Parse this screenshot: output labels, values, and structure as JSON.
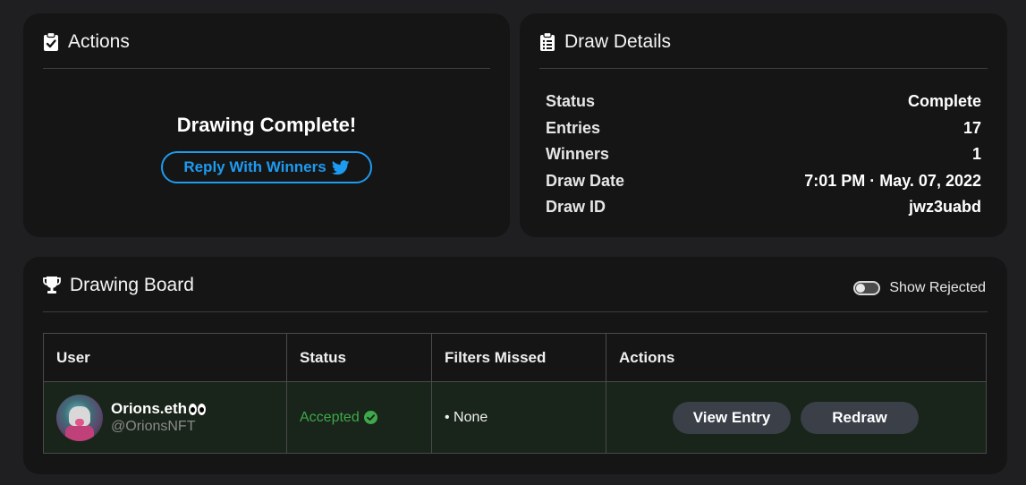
{
  "actions": {
    "title": "Actions",
    "complete_text": "Drawing Complete!",
    "reply_button_label": "Reply With Winners"
  },
  "details": {
    "title": "Draw Details",
    "rows": [
      {
        "label": "Status",
        "value": "Complete"
      },
      {
        "label": "Entries",
        "value": "17"
      },
      {
        "label": "Winners",
        "value": "1"
      },
      {
        "label": "Draw Date",
        "value": "7:01 PM · May. 07, 2022"
      },
      {
        "label": "Draw ID",
        "value": "jwz3uabd"
      }
    ]
  },
  "board": {
    "title": "Drawing Board",
    "toggle_label": "Show Rejected",
    "toggle_on": false,
    "columns": [
      "User",
      "Status",
      "Filters Missed",
      "Actions"
    ],
    "rows": [
      {
        "user_name": "Orions.eth",
        "user_handle": "@OrionsNFT",
        "status": "Accepted",
        "filters_missed": "• None",
        "view_label": "View Entry",
        "redraw_label": "Redraw"
      }
    ]
  },
  "colors": {
    "twitter_blue": "#1d9bf0",
    "accepted_green": "#3fa84a",
    "card_bg": "#151515",
    "page_bg": "#1f1f21"
  },
  "icons": {
    "actions": "clipboard-check-icon",
    "details": "clipboard-list-icon",
    "board": "trophy-icon",
    "reply": "twitter-bird-icon",
    "status": "check-circle-icon"
  }
}
